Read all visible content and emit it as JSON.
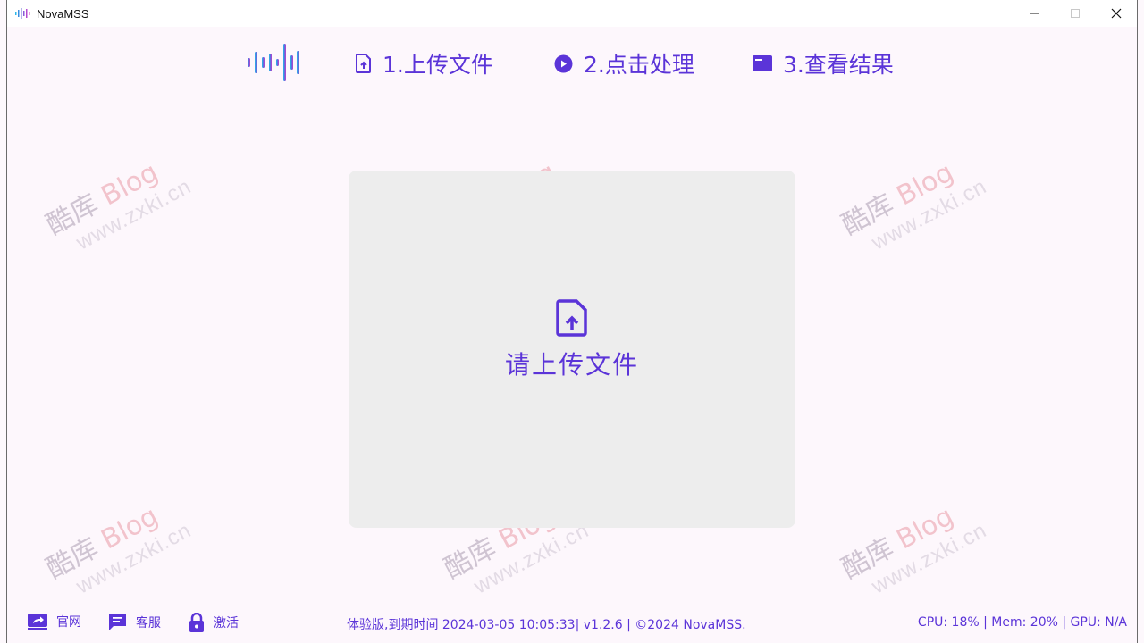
{
  "window": {
    "title": "NovaMSS"
  },
  "watermark": {
    "brand_cn": "酷库",
    "brand_en": "Blog",
    "url": "www.zxki.cn"
  },
  "steps": [
    {
      "label": "1.上传文件",
      "icon": "file-upload-icon"
    },
    {
      "label": "2.点击处理",
      "icon": "play-circle-icon"
    },
    {
      "label": "3.查看结果",
      "icon": "folder-icon"
    }
  ],
  "drop_zone": {
    "prompt": "请上传文件",
    "icon": "file-upload-icon"
  },
  "footer": {
    "links": [
      {
        "label": "官网",
        "icon": "share-icon"
      },
      {
        "label": "客服",
        "icon": "chat-icon"
      },
      {
        "label": "激活",
        "icon": "lock-icon"
      }
    ],
    "license_info": "体验版,到期时间 2024-03-05 10:05:33| v1.2.6 | ©2024 NovaMSS.",
    "system_stats": "CPU: 18% | Mem: 20% | GPU: N/A"
  },
  "colors": {
    "accent": "#5b34d8",
    "background": "#fdf7fc",
    "drop_zone": "#ededed"
  }
}
